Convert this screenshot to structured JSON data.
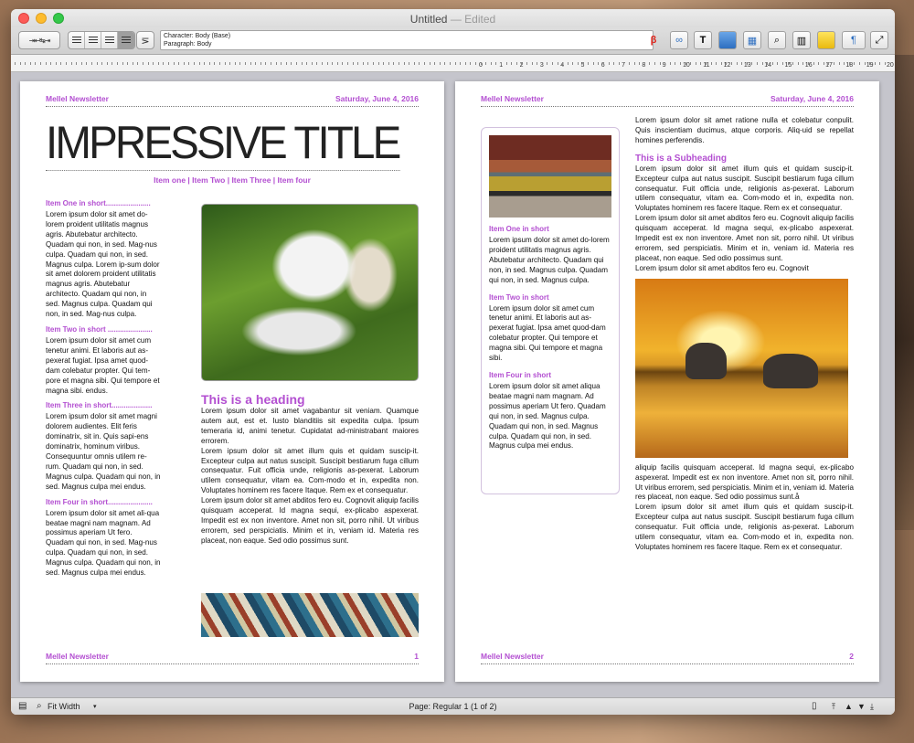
{
  "window": {
    "title": "Untitled",
    "edited": "— Edited"
  },
  "toolbar": {
    "tab_label": "⇥⇤↹⇥",
    "arrow": "⋝",
    "style_char": "Character: Body (Base)",
    "style_para": "Paragraph: Body",
    "beta": "β",
    "icons": [
      "link-icon",
      "text-box-icon",
      "image-icon",
      "table-icon",
      "find-icon",
      "sidebar-icon",
      "note-icon",
      "paragraph-icon",
      "fullscreen-icon"
    ]
  },
  "ruler": {
    "numbers": [
      "0",
      "1",
      "2",
      "3",
      "4",
      "5",
      "6",
      "7",
      "8",
      "9",
      "10",
      "11",
      "12",
      "13",
      "14",
      "15",
      "16",
      "17",
      "18",
      "19",
      "20"
    ]
  },
  "page1": {
    "header_left": "Mellel Newsletter",
    "header_right": "Saturday, June 4, 2016",
    "title": "IMPRESSIVE TITLE",
    "nav": "Item one | Item Two | Item Three | Item four",
    "side": [
      {
        "head": "Item One in short......................",
        "text": "Lorem ipsum dolor sit amet do-lorem proident utilitatis magnus agris. Abutebatur architecto. Quadam qui non, in sed. Mag-nus culpa. Quadam qui non, in sed. Magnus culpa. Lorem ip-sum dolor sit amet dolorem proident utilitatis magnus agris. Abutebatur architecto. Quadam qui non, in sed. Magnus culpa. Quadam qui non, in sed. Mag-nus culpa."
      },
      {
        "head": "Item Two in short ......................",
        "text": "Lorem ipsum dolor sit amet cum tenetur animi. Et laboris aut as-pexerat fugiat. Ipsa amet quod-dam colebatur propter. Qui tem-pore et magna sibi. Qui tempore et magna sibi. endus."
      },
      {
        "head": "Item Three in short....................",
        "text": "Lorem ipsum dolor sit amet magni dolorem audientes. Elit feris dominatrix, sit in. Quis sapi-ens dominatrix, hominum viribus. Consequuntur omnis utilem re-rum. Quadam qui non, in sed. Magnus culpa. Quadam qui non, in sed. Magnus culpa mei endus."
      },
      {
        "head": "Item Four in short......................",
        "text": "Lorem ipsum dolor sit amet ali-qua beatae magni nam magnam. Ad possimus aperiam Ut fero. Quadam qui non, in sed. Mag-nus culpa. Quadam qui non, in sed. Magnus culpa. Quadam qui non, in sed. Magnus culpa mei endus."
      }
    ],
    "heading": "This is a heading",
    "main_text": [
      "Lorem ipsum dolor sit amet vagabantur sit veniam. Quamque autem aut, est et. Iusto blanditiis sit expedita culpa. Ipsum temeraria id, animi tenetur. Cupidatat ad-ministrabant maiores errorem.",
      "Lorem ipsum dolor sit amet illum quis et quidam suscip-it. Excepteur culpa aut natus suscipit. Suscipit bestiarum fuga cillum consequatur. Fuit officia unde, religionis as-pexerat. Laborum utilem consequatur, vitam ea. Com-modo et in, expedita non. Voluptates hominem res facere Itaque. Rem ex et consequatur.",
      "Lorem ipsum dolor sit amet abditos fero eu. Cognovit aliquip facilis quisquam acceperat. Id magna sequi, ex-plicabo aspexerat. Impedit est ex non inventore. Amet non sit, porro nihil. Ut viribus errorem, sed perspiciatis. Minim et in, veniam id. Materia res placeat, non eaque. Sed odio possimus sunt."
    ],
    "footer_left": "Mellel Newsletter",
    "footer_right": "1"
  },
  "page2": {
    "header_left": "Mellel Newsletter",
    "header_right": "Saturday, June 4, 2016",
    "box": [
      {
        "head": "Item One in short",
        "text": "Lorem ipsum dolor sit amet do-lorem proident utilitatis magnus agris. Abutebatur architecto. Quadam qui non, in sed. Magnus culpa. Quadam qui non, in sed. Magnus culpa."
      },
      {
        "head": "Item Two in short",
        "text": "Lorem ipsum dolor sit amet cum tenetur animi. Et laboris aut as-pexerat fugiat. Ipsa amet quod-dam colebatur propter. Qui tempore et magna sibi. Qui tempore et magna sibi."
      },
      {
        "head": "Item Four in short",
        "text": "Lorem ipsum dolor sit amet aliqua beatae magni nam magnam. Ad possimus aperiam Ut fero. Quadam qui non, in sed. Magnus culpa. Quadam qui non, in sed. Magnus culpa. Quadam qui non, in sed. Magnus culpa mei endus."
      }
    ],
    "intro": "Lorem ipsum dolor sit amet ratione nulla et colebatur conpulit. Quis inscientiam ducimus, atque corporis. Aliq-uid se repellat homines perferendis.",
    "subheading": "This is a Subheading",
    "sub_text": [
      "Lorem ipsum dolor sit amet illum quis et quidam suscip-it. Excepteur culpa aut natus suscipit. Suscipit bestiarum fuga cillum consequatur. Fuit officia unde, religionis as-pexerat. Laborum utilem consequatur, vitam ea. Com-modo et in, expedita non. Voluptates hominem res facere Itaque. Rem ex et consequatur.",
      "Lorem ipsum dolor sit amet abditos fero eu. Cognovit aliquip facilis quisquam acceperat. Id magna sequi, ex-plicabo aspexerat. Impedit est ex non inventore. Amet non sit, porro nihil. Ut viribus errorem, sed perspiciatis. Minim et in, veniam id. Materia res placeat, non eaque. Sed odio possimus sunt.",
      "Lorem ipsum dolor sit amet abditos fero eu. Cognovit"
    ],
    "after_text": [
      "aliquip facilis quisquam acceperat. Id magna sequi, ex-plicabo aspexerat. Impedit est ex non inventore. Amet non sit, porro nihil. Ut viribus errorem, sed perspiciatis. Minim et in, veniam id. Materia res placeat, non eaque. Sed odio possimus sunt.å",
      "Lorem ipsum dolor sit amet illum quis et quidam suscip-it. Excepteur culpa aut natus suscipit. Suscipit bestiarum fuga cillum consequatur. Fuit officia unde, religionis as-pexerat. Laborum utilem consequatur, vitam ea. Com-modo et in, expedita non. Voluptates hominem res facere Itaque. Rem ex et consequatur."
    ],
    "footer_left": "Mellel Newsletter",
    "footer_right": "2"
  },
  "statusbar": {
    "zoom": "Fit Width",
    "page_info": "Page: Regular 1 (1 of 2)"
  },
  "colors": {
    "accent": "#b34fd1"
  }
}
